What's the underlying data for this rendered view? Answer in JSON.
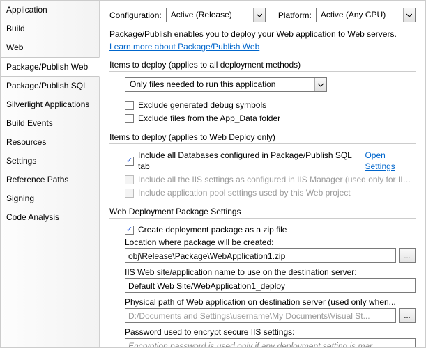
{
  "sidebar": {
    "items": [
      {
        "label": "Application"
      },
      {
        "label": "Build"
      },
      {
        "label": "Web"
      },
      {
        "label": "Package/Publish Web",
        "selected": true
      },
      {
        "label": "Package/Publish SQL"
      },
      {
        "label": "Silverlight Applications"
      },
      {
        "label": "Build Events"
      },
      {
        "label": "Resources"
      },
      {
        "label": "Settings"
      },
      {
        "label": "Reference Paths"
      },
      {
        "label": "Signing"
      },
      {
        "label": "Code Analysis"
      }
    ]
  },
  "toprow": {
    "config_label": "Configuration:",
    "config_value": "Active (Release)",
    "platform_label": "Platform:",
    "platform_value": "Active (Any CPU)"
  },
  "intro": {
    "text": "Package/Publish enables you to deploy your Web application to Web servers.",
    "link": "Learn more about Package/Publish Web"
  },
  "section1": {
    "title": "Items to deploy (applies to all deployment methods)",
    "dropdown": "Only files needed to run this application",
    "chk1": "Exclude generated debug symbols",
    "chk2": "Exclude files from the App_Data folder"
  },
  "section2": {
    "title": "Items to deploy (applies to Web Deploy only)",
    "chk1": "Include all Databases configured in Package/Publish SQL tab",
    "open_settings": "Open Settings",
    "chk2": "Include all the IIS settings as configured in IIS Manager (used only for IIS ...",
    "chk3": "Include application pool settings used by this Web project"
  },
  "section3": {
    "title": "Web Deployment Package Settings",
    "chk1": "Create deployment package as a zip file",
    "loc_label": "Location where package will be created:",
    "loc_value": "obj\\Release\\Package\\WebApplication1.zip",
    "iis_label": "IIS Web site/application name to use on the destination server:",
    "iis_value": "Default Web Site/WebApplication1_deploy",
    "phys_label": "Physical path of Web application on destination server (used only when...",
    "phys_value": "D:/Documents and Settings\\username\\My Documents\\Visual St...",
    "pwd_label": "Password used to encrypt secure IIS settings:",
    "pwd_placeholder": "Encryption password is used only if any deployment setting is mar...",
    "browse": "..."
  }
}
